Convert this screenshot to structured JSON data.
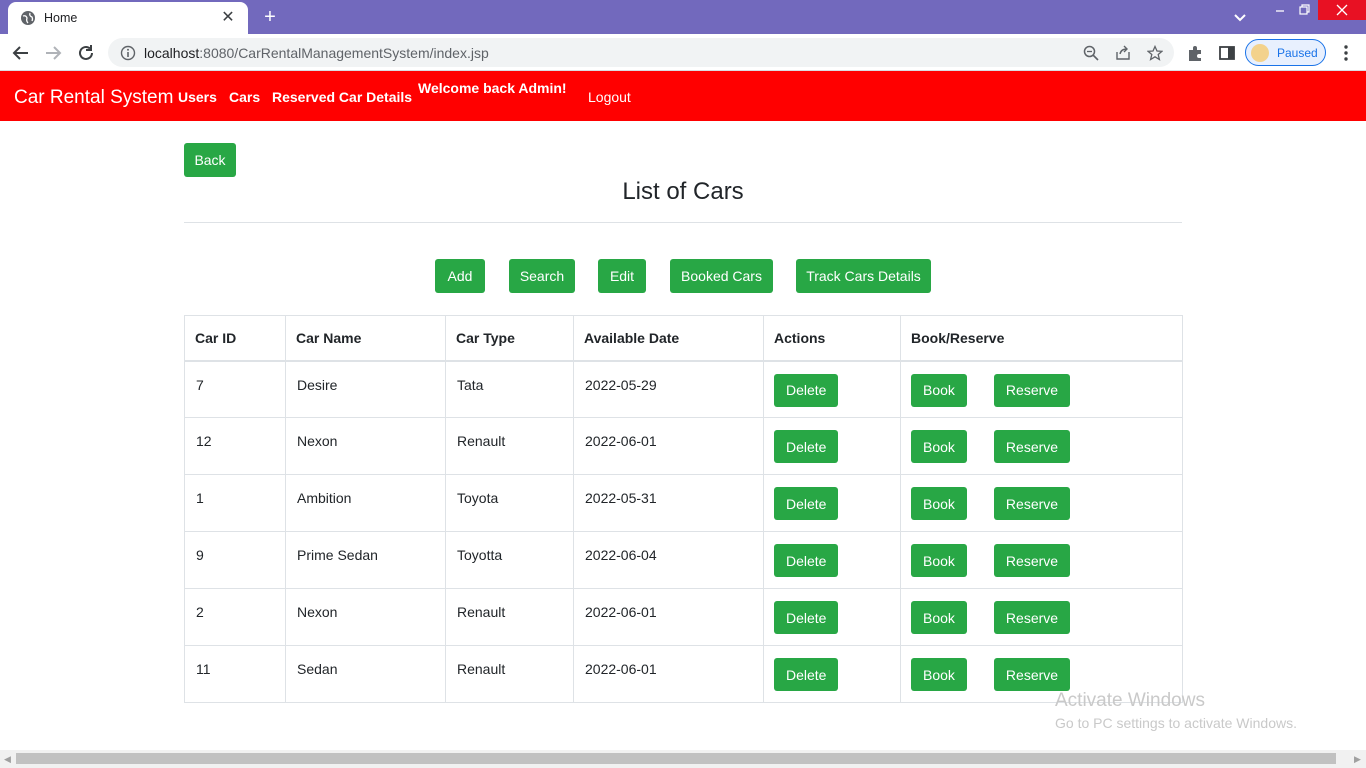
{
  "browser": {
    "tab_title": "Home",
    "tab_close": "✕",
    "new_tab": "+",
    "url_host": "localhost",
    "url_rest": ":8080/CarRentalManagementSystem/index.jsp",
    "profile_label": "Paused"
  },
  "nav": {
    "brand": "Car Rental System",
    "links": [
      "Users",
      "Cars",
      "Reserved Car Details"
    ],
    "welcome": "Welcome back Admin!",
    "logout": "Logout"
  },
  "page": {
    "back_label": "Back",
    "title": "List of Cars",
    "actions": [
      "Add",
      "Search",
      "Edit",
      "Booked Cars",
      "Track Cars Details"
    ]
  },
  "table": {
    "headers": [
      "Car ID",
      "Car Name",
      "Car Type",
      "Available Date",
      "Actions",
      "Book/Reserve"
    ],
    "delete_label": "Delete",
    "book_label": "Book",
    "reserve_label": "Reserve",
    "rows": [
      {
        "id": "7",
        "name": "Desire",
        "type": "Tata",
        "date": "2022-05-29"
      },
      {
        "id": "12",
        "name": "Nexon",
        "type": "Renault",
        "date": "2022-06-01"
      },
      {
        "id": "1",
        "name": "Ambition",
        "type": "Toyota",
        "date": "2022-05-31"
      },
      {
        "id": "9",
        "name": "Prime Sedan",
        "type": "Toyotta",
        "date": "2022-06-04"
      },
      {
        "id": "2",
        "name": "Nexon",
        "type": "Renault",
        "date": "2022-06-01"
      },
      {
        "id": "11",
        "name": "Sedan",
        "type": "Renault",
        "date": "2022-06-01"
      }
    ]
  },
  "watermark": {
    "line1": "Activate Windows",
    "line2": "Go to PC settings to activate Windows."
  },
  "colors": {
    "navbar": "#ff0000",
    "button": "#28a745",
    "tabbar": "#7269bd"
  }
}
